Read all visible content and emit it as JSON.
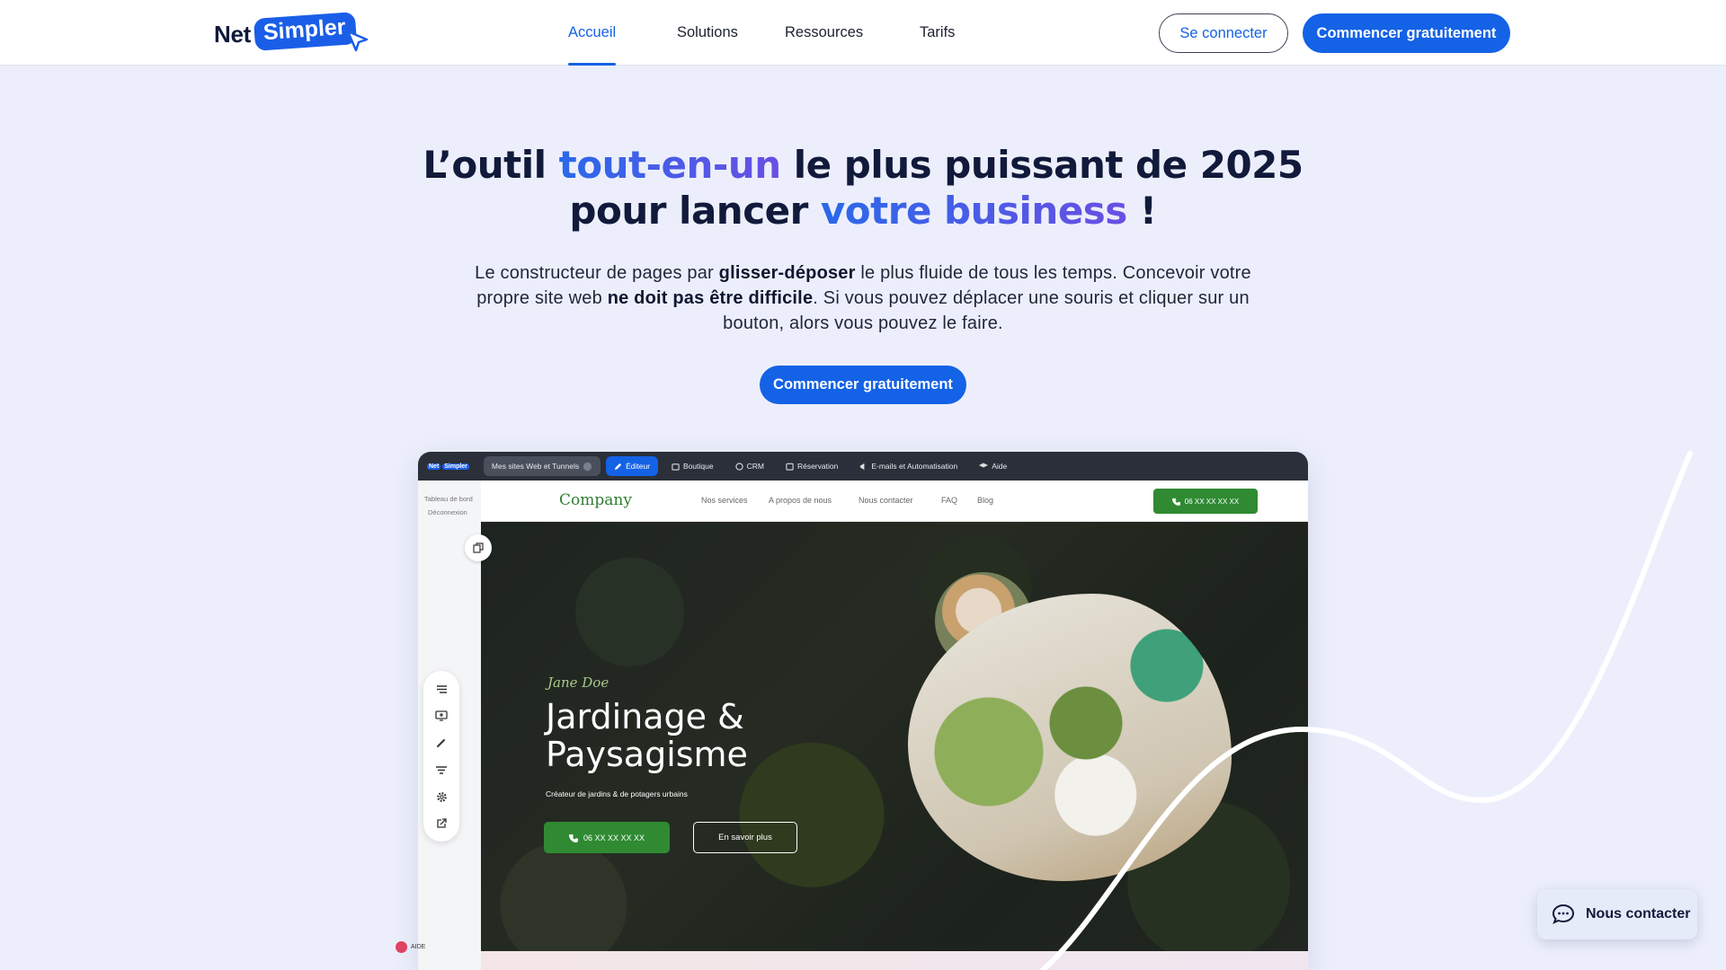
{
  "brand": {
    "part1": "Net",
    "part2": "Simpler"
  },
  "nav": {
    "items": [
      "Accueil",
      "Solutions",
      "Ressources",
      "Tarifs"
    ],
    "active": "Accueil",
    "login_label": "Se connecter",
    "cta_label": "Commencer gratuitement"
  },
  "hero": {
    "title": {
      "t1": "L’outil ",
      "h1": "tout-en-un",
      "t2": " le plus puissant de 2025 pour lancer ",
      "h2": "votre business",
      "t3": " !"
    },
    "subtitle": {
      "s1": "Le constructeur de pages par ",
      "b1": "glisser-déposer",
      "s2": " le plus fluide de tous les temps. Concevoir votre propre site web ",
      "b2": "ne doit pas être difficile",
      "s3": ". Si vous pouvez déplacer une souris et cliquer sur un bouton, alors vous pouvez le faire."
    },
    "cta_label": "Commencer gratuitement"
  },
  "editor": {
    "toolbar": [
      "Mes sites Web et Tunnels",
      "Éditeur",
      "Boutique",
      "CRM",
      "Réservation",
      "E-mails et Automatisation",
      "Aide"
    ],
    "logo_a": "Net",
    "logo_b": "Simpler",
    "left_link_dashboard": "Tableau de bord",
    "left_link_logout": "Déconnexion",
    "help_label": "AIDE"
  },
  "preview": {
    "company": "Company",
    "nav": [
      "Nos services",
      "A propos de nous",
      "Nous contacter",
      "FAQ",
      "Blog"
    ],
    "phone": "06 XX XX XX XX",
    "tagline_name": "Jane Doe",
    "title_line1": "Jardinage &",
    "title_line2": "Paysagisme",
    "subtitle": "Créateur de jardins & de potagers urbains",
    "phone_button": "06 XX XX XX XX",
    "more_button": "En savoir plus"
  },
  "contact_widget": {
    "label": "Nous contacter"
  },
  "colors": {
    "primary": "#1462e6",
    "dark": "#111a3a",
    "background": "#eceffb",
    "green": "#2f8a32"
  }
}
